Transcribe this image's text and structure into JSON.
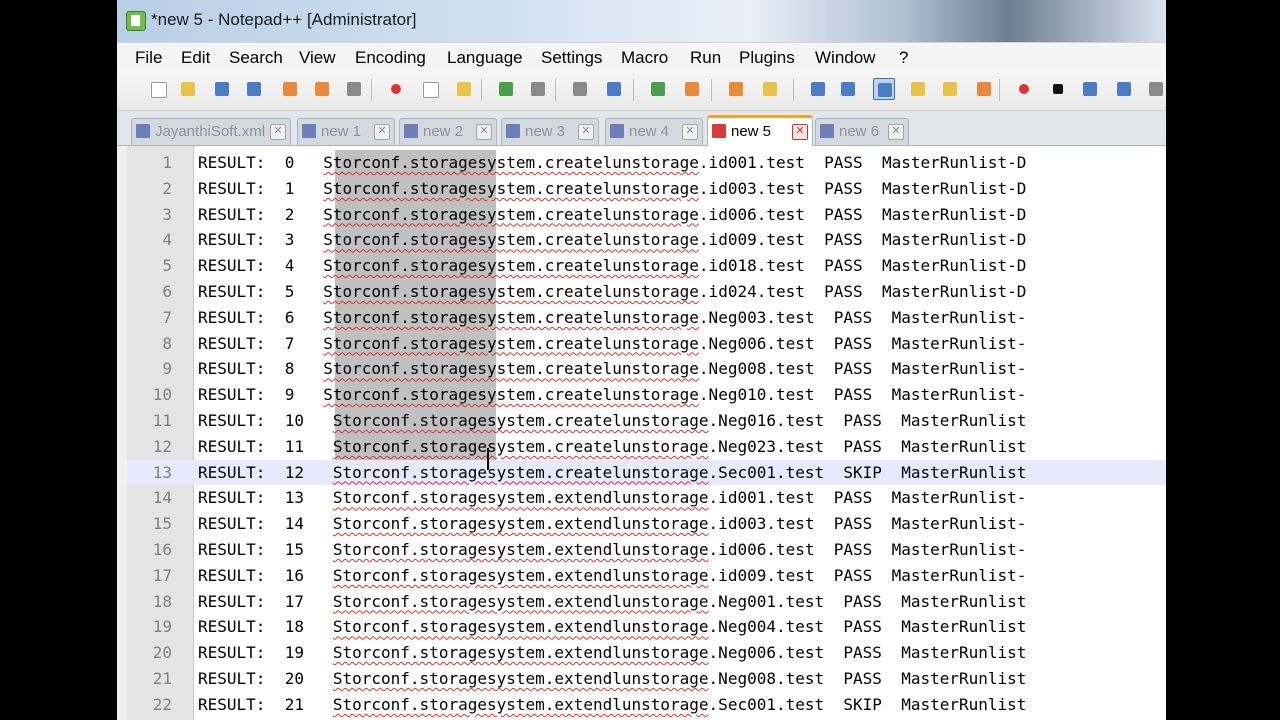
{
  "window": {
    "title": "*new  5 - Notepad++ [Administrator]"
  },
  "menu": [
    "File",
    "Edit",
    "Search",
    "View",
    "Encoding",
    "Language",
    "Settings",
    "Macro",
    "Run",
    "Plugins",
    "Window",
    "?"
  ],
  "toolbar_icons": [
    "new-file-icon",
    "open-file-icon",
    "save-icon",
    "save-all-icon",
    "close-icon",
    "close-all-icon",
    "print-icon",
    "cut-icon",
    "copy-icon",
    "paste-icon",
    "undo-icon",
    "redo-icon",
    "find-icon",
    "replace-icon",
    "zoom-in-icon",
    "zoom-out-icon",
    "sync-vertical-icon",
    "sync-horizontal-icon",
    "word-wrap-icon",
    "show-all-characters-icon",
    "indent-guide-icon",
    "user-language-icon",
    "doc-map-icon",
    "function-list-icon",
    "record-macro-icon",
    "stop-recording-icon",
    "playback-macro-icon",
    "run-macro-multiple-icon",
    "save-macro-icon"
  ],
  "tabs": [
    {
      "label": "JayanthiSoft.xml",
      "active": false
    },
    {
      "label": "new  1",
      "active": false
    },
    {
      "label": "new  2",
      "active": false
    },
    {
      "label": "new  3",
      "active": false
    },
    {
      "label": "new  4",
      "active": false
    },
    {
      "label": "new  5",
      "active": true
    },
    {
      "label": "new  6",
      "active": false
    }
  ],
  "editor": {
    "current_line": 13,
    "lines": [
      {
        "n": "1",
        "text": "RESULT:  0   Storconf.storagesystem.createlunstorage.id001.test  PASS  MasterRunlist-D"
      },
      {
        "n": "2",
        "text": "RESULT:  1   Storconf.storagesystem.createlunstorage.id003.test  PASS  MasterRunlist-D"
      },
      {
        "n": "3",
        "text": "RESULT:  2   Storconf.storagesystem.createlunstorage.id006.test  PASS  MasterRunlist-D"
      },
      {
        "n": "4",
        "text": "RESULT:  3   Storconf.storagesystem.createlunstorage.id009.test  PASS  MasterRunlist-D"
      },
      {
        "n": "5",
        "text": "RESULT:  4   Storconf.storagesystem.createlunstorage.id018.test  PASS  MasterRunlist-D"
      },
      {
        "n": "6",
        "text": "RESULT:  5   Storconf.storagesystem.createlunstorage.id024.test  PASS  MasterRunlist-D"
      },
      {
        "n": "7",
        "text": "RESULT:  6   Storconf.storagesystem.createlunstorage.Neg003.test  PASS  MasterRunlist-"
      },
      {
        "n": "8",
        "text": "RESULT:  7   Storconf.storagesystem.createlunstorage.Neg006.test  PASS  MasterRunlist-"
      },
      {
        "n": "9",
        "text": "RESULT:  8   Storconf.storagesystem.createlunstorage.Neg008.test  PASS  MasterRunlist-"
      },
      {
        "n": "10",
        "text": "RESULT:  9   Storconf.storagesystem.createlunstorage.Neg010.test  PASS  MasterRunlist-"
      },
      {
        "n": "11",
        "text": "RESULT:  10   Storconf.storagesystem.createlunstorage.Neg016.test  PASS  MasterRunlist"
      },
      {
        "n": "12",
        "text": "RESULT:  11   Storconf.storagesystem.createlunstorage.Neg023.test  PASS  MasterRunlist"
      },
      {
        "n": "13",
        "text": "RESULT:  12   Storconf.storagesystem.createlunstorage.Sec001.test  SKIP  MasterRunlist"
      },
      {
        "n": "14",
        "text": "RESULT:  13   Storconf.storagesystem.extendlunstorage.id001.test  PASS  MasterRunlist-"
      },
      {
        "n": "15",
        "text": "RESULT:  14   Storconf.storagesystem.extendlunstorage.id003.test  PASS  MasterRunlist-"
      },
      {
        "n": "16",
        "text": "RESULT:  15   Storconf.storagesystem.extendlunstorage.id006.test  PASS  MasterRunlist-"
      },
      {
        "n": "17",
        "text": "RESULT:  16   Storconf.storagesystem.extendlunstorage.id009.test  PASS  MasterRunlist-"
      },
      {
        "n": "18",
        "text": "RESULT:  17   Storconf.storagesystem.extendlunstorage.Neg001.test  PASS  MasterRunlist"
      },
      {
        "n": "19",
        "text": "RESULT:  18   Storconf.storagesystem.extendlunstorage.Neg004.test  PASS  MasterRunlist"
      },
      {
        "n": "20",
        "text": "RESULT:  19   Storconf.storagesystem.extendlunstorage.Neg006.test  PASS  MasterRunlist"
      },
      {
        "n": "21",
        "text": "RESULT:  20   Storconf.storagesystem.extendlunstorage.Neg008.test  PASS  MasterRunlist"
      },
      {
        "n": "22",
        "text": "RESULT:  21   Storconf.storagesystem.extendlunstorage.Sec001.test  SKIP  MasterRunlist"
      }
    ]
  }
}
